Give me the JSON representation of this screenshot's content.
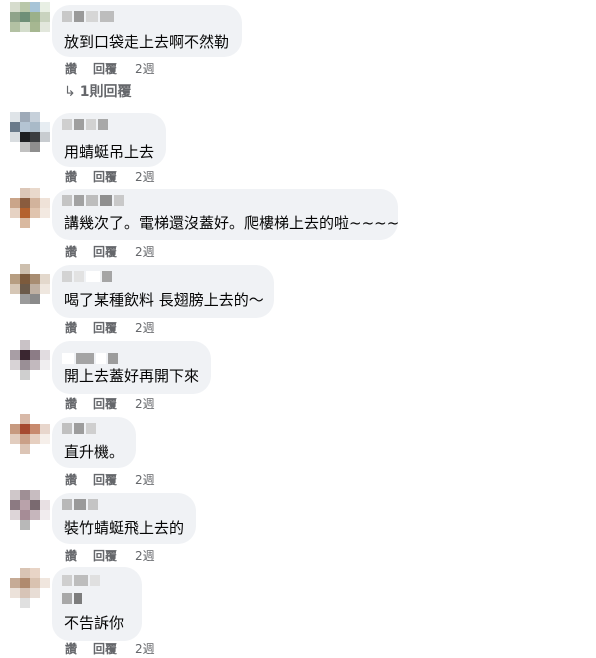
{
  "labels": {
    "like": "讚",
    "reply": "回覆",
    "time": "2週"
  },
  "replies_link": "1則回覆",
  "comments": [
    {
      "text": "放到口袋走上去啊不然勒"
    },
    {
      "text": "用蜻蜓吊上去"
    },
    {
      "text": "講幾次了。電梯還沒蓋好。爬樓梯上去的啦~~~~"
    },
    {
      "text": "喝了某種飲料 長翅膀上去的～"
    },
    {
      "text": "開上去蓋好再開下來"
    },
    {
      "text": "直升機。"
    },
    {
      "text": "裝竹蜻蜓飛上去的"
    },
    {
      "text": "不告訴你"
    }
  ],
  "colors": {
    "bubble": "#f0f2f5",
    "meta_text": "#65676b",
    "text": "#050505"
  }
}
